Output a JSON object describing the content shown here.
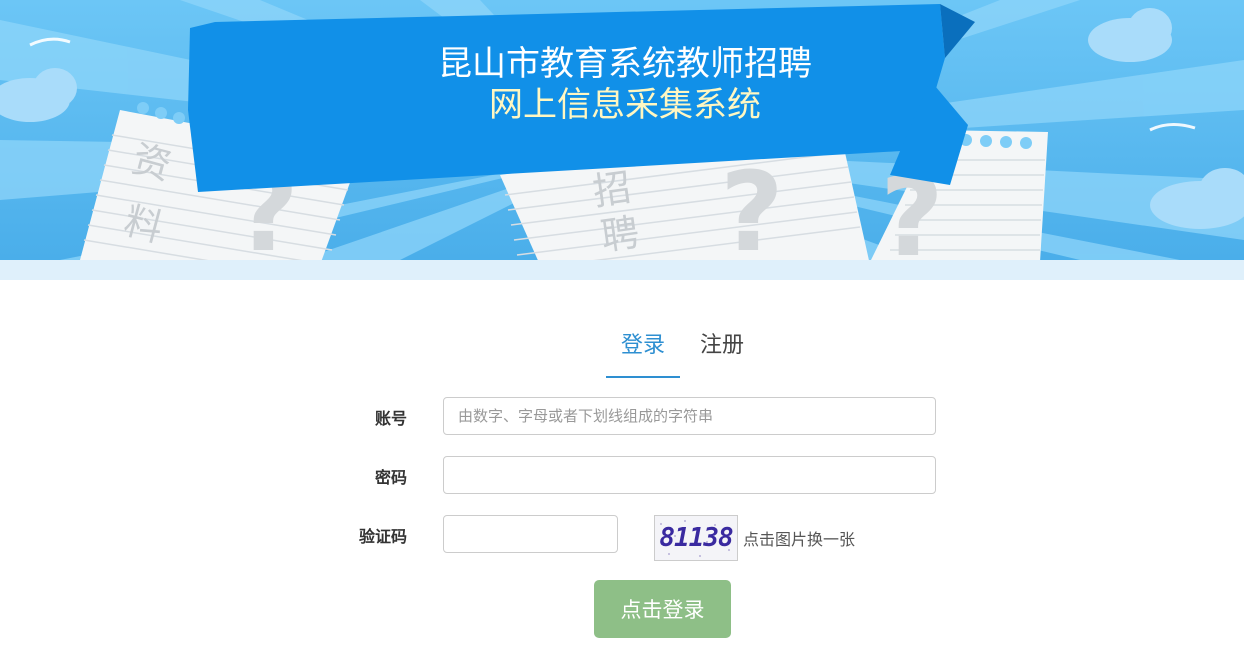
{
  "header": {
    "title_line1": "昆山市教育系统教师招聘",
    "title_line2": "网上信息采集系统",
    "deco_paper_left": "资料",
    "deco_paper_middle": "招聘"
  },
  "tabs": [
    {
      "label": "登录",
      "active": true
    },
    {
      "label": "注册",
      "active": false
    }
  ],
  "form": {
    "account_label": "账号",
    "account_placeholder": "由数字、字母或者下划线组成的字符串",
    "account_value": "",
    "password_label": "密码",
    "password_value": "",
    "captcha_label": "验证码",
    "captcha_value": "",
    "captcha_image_text": "81138",
    "captcha_refresh_hint": "点击图片换一张",
    "submit_label": "点击登录"
  },
  "colors": {
    "banner_sky": "#5bbcf2",
    "ribbon": "#1190e8",
    "title_line2_color": "#fff7c2",
    "active_tab": "#2e8fd1",
    "submit_bg": "#8ebf87"
  }
}
